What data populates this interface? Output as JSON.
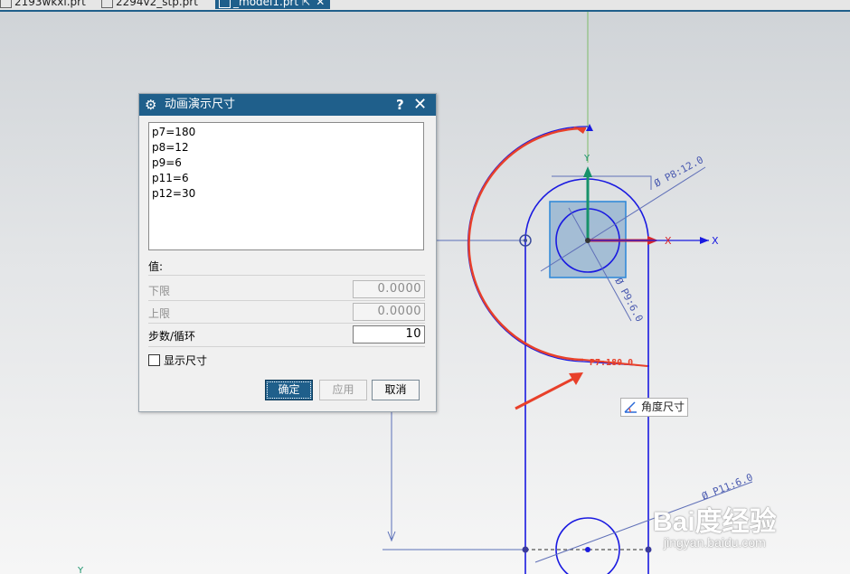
{
  "tabs": [
    {
      "label": "2193wkxl.prt"
    },
    {
      "label": "2294v2_stp.prt"
    },
    {
      "label": "_model1.prt"
    }
  ],
  "dialog": {
    "title": "动画演示尺寸",
    "help_label": "?",
    "close_label": "✕",
    "list_items": [
      "p7=180",
      "p8=12",
      "p9=6",
      "p11=6",
      "p12=30"
    ],
    "value_label": "值:",
    "lower_label": "下限",
    "lower_value": "0.0000",
    "upper_label": "上限",
    "upper_value": "0.0000",
    "steps_label": "步数/循环",
    "steps_value": "10",
    "show_dims_label": "显示尺寸",
    "show_dims_checked": false,
    "ok_label": "确定",
    "apply_label": "应用",
    "cancel_label": "取消"
  },
  "canvas": {
    "dim_p8": "Ø P8:12.0",
    "dim_p9": "Ø P9:6.0",
    "dim_p7": "P7:180.0",
    "dim_p11": "Ø P11:6.0",
    "axis_x1": "X",
    "axis_x2": "X",
    "axis_y": "Y"
  },
  "tooltip": {
    "label": "角度尺寸",
    "icon": "angle-dimension-icon"
  },
  "watermark": {
    "logo": "Bai度经验",
    "url": "jingyan.baidu.com"
  },
  "colors": {
    "accent": "#1f5f8b",
    "sketch_blue": "#1010e0",
    "annotation_red": "#e8402a"
  }
}
